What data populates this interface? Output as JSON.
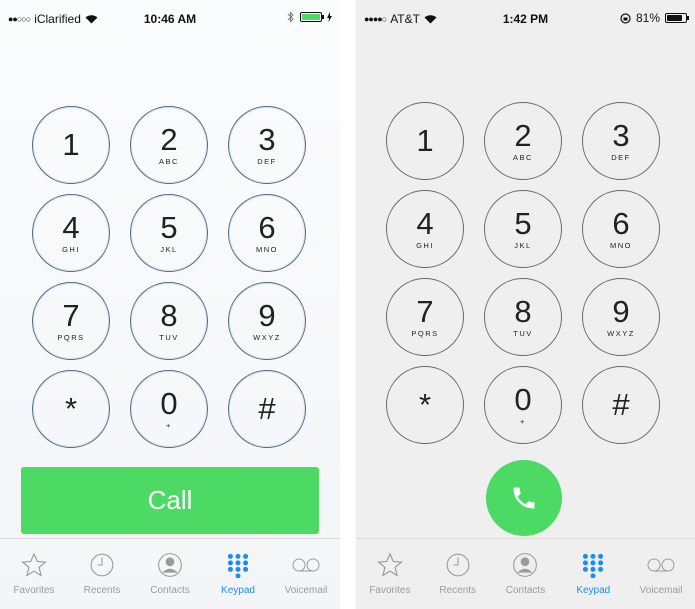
{
  "colors": {
    "accent": "#1e8cf0",
    "call_green": "#4cd964",
    "tab_gray": "#9b9b9b"
  },
  "left": {
    "status": {
      "carrier": "iClarified",
      "time": "10:46 AM",
      "signal": "●●○○○"
    },
    "keys": [
      {
        "digit": "1",
        "letters": ""
      },
      {
        "digit": "2",
        "letters": "ABC"
      },
      {
        "digit": "3",
        "letters": "DEF"
      },
      {
        "digit": "4",
        "letters": "GHI"
      },
      {
        "digit": "5",
        "letters": "JKL"
      },
      {
        "digit": "6",
        "letters": "MNO"
      },
      {
        "digit": "7",
        "letters": "PQRS"
      },
      {
        "digit": "8",
        "letters": "TUV"
      },
      {
        "digit": "9",
        "letters": "WXYZ"
      },
      {
        "digit": "*",
        "letters": ""
      },
      {
        "digit": "0",
        "letters": "+"
      },
      {
        "digit": "#",
        "letters": ""
      }
    ],
    "call_label": "Call",
    "tabs": [
      "Favorites",
      "Recents",
      "Contacts",
      "Keypad",
      "Voicemail"
    ]
  },
  "right": {
    "status": {
      "carrier": "AT&T",
      "time": "1:42 PM",
      "battery": "81%",
      "signal": "●●●●○"
    },
    "keys": [
      {
        "digit": "1",
        "letters": ""
      },
      {
        "digit": "2",
        "letters": "ABC"
      },
      {
        "digit": "3",
        "letters": "DEF"
      },
      {
        "digit": "4",
        "letters": "GHI"
      },
      {
        "digit": "5",
        "letters": "JKL"
      },
      {
        "digit": "6",
        "letters": "MNO"
      },
      {
        "digit": "7",
        "letters": "PQRS"
      },
      {
        "digit": "8",
        "letters": "TUV"
      },
      {
        "digit": "9",
        "letters": "WXYZ"
      },
      {
        "digit": "*",
        "letters": ""
      },
      {
        "digit": "0",
        "letters": "+"
      },
      {
        "digit": "#",
        "letters": ""
      }
    ],
    "tabs": [
      "Favorites",
      "Recents",
      "Contacts",
      "Keypad",
      "Voicemail"
    ]
  },
  "active_tab": "Keypad",
  "icons": [
    "star-icon",
    "clock-icon",
    "contact-icon",
    "keypad-icon",
    "voicemail-icon",
    "phone-icon",
    "wifi-icon",
    "bluetooth-icon",
    "battery-icon",
    "rotation-lock-icon"
  ]
}
